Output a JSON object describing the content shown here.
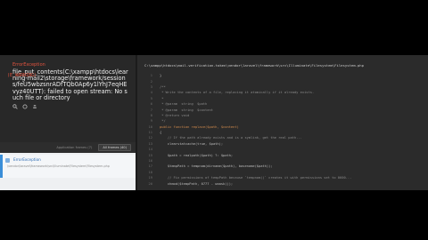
{
  "exception": {
    "type": "ErrorException",
    "code": "(E_WARNING)",
    "message": "file_put_contents(C:\\xampp\\htdocs\\learning-mail2\\storage\\framework/sessions/feU5wbzsnrADfTQb0Ap6y1lYhJ7eqHEvyz40UTT): failed to open stream: No such file or directory"
  },
  "toolbar": {
    "app_frames_label": "Application frames (7)",
    "all_frames_label": "All frames (40)"
  },
  "stack": [
    {
      "index": "1",
      "class": "ErrorException",
      "file": "\\vendor\\laravel\\framework\\src\\Illuminate\\Filesystem\\Filesystem.php"
    }
  ],
  "editor": {
    "file_path": "C:\\xampp\\htdocs\\mail-verification-token\\vendor\\laravel\\framework\\src\\Illuminate\\Filesystem\\Filesystem.php",
    "lines": [
      {
        "n": "1",
        "t": "}",
        "k": ""
      },
      {
        "n": "2",
        "t": "",
        "k": ""
      },
      {
        "n": "3",
        "t": "/**",
        "k": "comment"
      },
      {
        "n": "4",
        "t": " * Write the contents of a file, replacing it atomically if it already exists.",
        "k": "comment"
      },
      {
        "n": "5",
        "t": " *",
        "k": "comment"
      },
      {
        "n": "6",
        "t": " * @param  string  $path",
        "k": "comment"
      },
      {
        "n": "7",
        "t": " * @param  string  $content",
        "k": "comment"
      },
      {
        "n": "8",
        "t": " * @return void",
        "k": "comment"
      },
      {
        "n": "9",
        "t": " */",
        "k": "comment"
      },
      {
        "n": "10",
        "t": "public function replace($path, $content)",
        "k": "kw"
      },
      {
        "n": "11",
        "t": "{",
        "k": ""
      },
      {
        "n": "12",
        "t": "    // If the path already exists and is a symlink, get the real path...",
        "k": "comment"
      },
      {
        "n": "13",
        "t": "    clearstatcache(true, $path);",
        "k": ""
      },
      {
        "n": "14",
        "t": "",
        "k": ""
      },
      {
        "n": "15",
        "t": "    $path = realpath($path) ?: $path;",
        "k": ""
      },
      {
        "n": "16",
        "t": "",
        "k": ""
      },
      {
        "n": "17",
        "t": "    $tempPath = tempnam(dirname($path), basename($path));",
        "k": ""
      },
      {
        "n": "18",
        "t": "",
        "k": ""
      },
      {
        "n": "19",
        "t": "    // Fix permissions of tempPath because `tempnam()` creates it with permissions set to 0600...",
        "k": "comment"
      },
      {
        "n": "20",
        "t": "    chmod($tempPath, 0777 - umask());",
        "k": ""
      }
    ]
  }
}
